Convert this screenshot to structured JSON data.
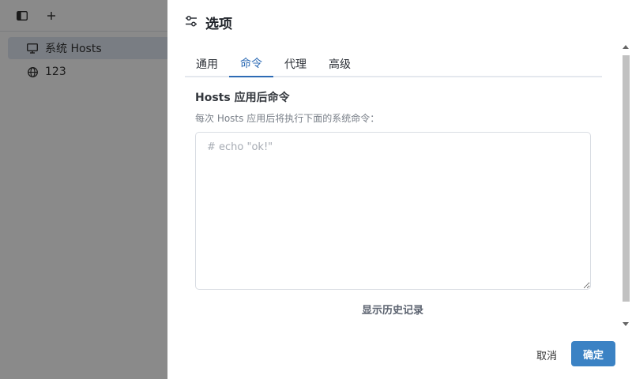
{
  "sidebar": {
    "items": [
      {
        "label": "系统 Hosts",
        "icon": "monitor-icon",
        "active": true
      },
      {
        "label": "123",
        "icon": "globe-icon",
        "active": false
      }
    ]
  },
  "toolbar": {
    "icons": [
      "sidebar-toggle-icon",
      "plus-icon"
    ]
  },
  "dialog": {
    "title": "选项",
    "title_icon": "sliders-icon",
    "tabs": [
      {
        "label": "通用",
        "active": false
      },
      {
        "label": "命令",
        "active": true
      },
      {
        "label": "代理",
        "active": false
      },
      {
        "label": "高级",
        "active": false
      }
    ],
    "section_title": "Hosts 应用后命令",
    "section_desc": "每次 Hosts 应用后将执行下面的系统命令：",
    "command_placeholder": "# echo \"ok!\"",
    "command_value": "",
    "history_link": "显示历史记录",
    "cancel_label": "取消",
    "ok_label": "确定"
  },
  "colors": {
    "accent": "#2d6bb5",
    "ok_button": "#3b82c4",
    "overlay": "rgba(0,0,0,0.46)"
  }
}
